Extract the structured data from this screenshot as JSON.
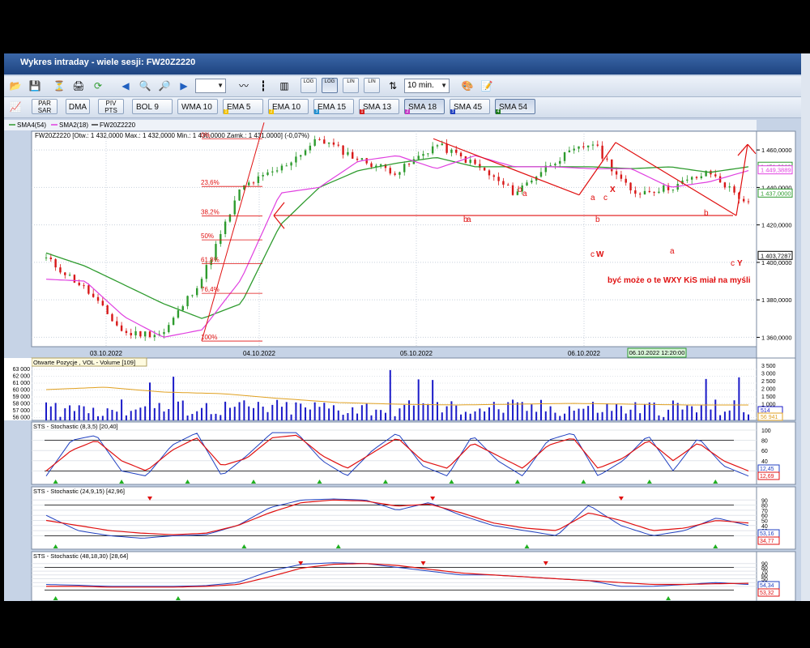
{
  "window": {
    "title": "Wykres intraday -  wiele sesji: FW20Z2220"
  },
  "toolbar1": {
    "interval": "10 min.",
    "icons": [
      "open-folder-icon",
      "save-icon",
      "hourglass-icon",
      "print-icon",
      "refresh-icon",
      "arrow-left-icon",
      "zoom-in-icon",
      "zoom-out-icon",
      "arrow-right-icon",
      "line-chart-icon",
      "ohlc-chart-icon",
      "candle-chart-icon",
      "log-icon",
      "log-icon",
      "lin-icon",
      "lin-icon",
      "scale-icon",
      "palette-icon",
      "notes-icon"
    ],
    "log_labels": [
      "LOG",
      "LOG",
      "LIN",
      "LIN"
    ]
  },
  "toolbar2": {
    "items": [
      {
        "label": "PAR\nSAR",
        "param": "",
        "color": ""
      },
      {
        "label": "DMA",
        "param": "",
        "color": ""
      },
      {
        "label": "PIV\nPTS",
        "param": "",
        "color": ""
      },
      {
        "label": "BOL",
        "param": "9",
        "color": ""
      },
      {
        "label": "WMA",
        "param": "10",
        "color": "#f0c000"
      },
      {
        "label": "EMA",
        "param": "5",
        "color": "#f0c000"
      },
      {
        "label": "EMA",
        "param": "10",
        "color": "#2a9d2a"
      },
      {
        "label": "EMA",
        "param": "15",
        "color": "#1f8fd0"
      },
      {
        "label": "SMA",
        "param": "13",
        "color": "#d42020"
      },
      {
        "label": "SMA",
        "param": "18",
        "color": "#c43bc4"
      },
      {
        "label": "SMA",
        "param": "45",
        "color": "#2040c0"
      },
      {
        "label": "SMA",
        "param": "54",
        "color": "#207a20"
      }
    ],
    "small_numbers": [
      "1",
      "2",
      "3",
      "1",
      "2",
      "3",
      "4"
    ]
  },
  "legend": [
    {
      "name": "SMA4(54)",
      "color": "#2e9b2e"
    },
    {
      "name": "SMA2(18)",
      "color": "#e040e0"
    },
    {
      "name": "FW20Z2220",
      "color": "#333333"
    }
  ],
  "price_header": "FW20Z2220 [Otw.: 1 432,0000  Max.: 1 432,0000  Min.: 1 430,0000  Zamk.: 1 431,0000] (-0,07%)",
  "annotation_text": "być może o te WXY KiS miał na myśli",
  "fib_labels": [
    "0%",
    "23,6%",
    "38,2%",
    "50%",
    "61,8%",
    "76,4%",
    "100%"
  ],
  "wave_labels": [
    "a",
    "b",
    "a",
    "b",
    "c",
    "X",
    "c",
    "W",
    "a",
    "b",
    "a",
    "b",
    "c",
    "Y"
  ],
  "date_ticks": [
    "03.10.2022",
    "04.10.2022",
    "05.10.2022",
    "06.10.2022"
  ],
  "cursor_date": "06.10.2022 12:20:00",
  "price_axis": {
    "ticks": [
      "1 460,0000",
      "1 440,0000",
      "1 420,0000",
      "1 400,0000",
      "1 380,0000",
      "1 360,0000"
    ],
    "markers": [
      {
        "text": "1 451,2963",
        "color": "#2e9b2e"
      },
      {
        "text": "1 449,3889",
        "color": "#e040e0"
      },
      {
        "text": "1 437,0000",
        "color": "#2e9b2e"
      },
      {
        "text": "1 403,7287",
        "color": "#000000"
      }
    ]
  },
  "volume_panel": {
    "title": "Otwarte Pozycje , VOL - Volume [109]",
    "left_ticks": [
      "63 000",
      "62 000",
      "61 000",
      "60 000",
      "59 000",
      "58 000",
      "57 000",
      "56 000"
    ],
    "right_ticks": [
      "3 500",
      "3 000",
      "2 500",
      "2 000",
      "1 500",
      "1 000",
      "500"
    ],
    "markers": [
      "514",
      "56 941"
    ]
  },
  "stoch_panels": [
    {
      "title": "STS - Stochastic (8,3,5) [20,40]",
      "ticks": [
        "100",
        "80",
        "60",
        "40",
        "20"
      ],
      "markers": [
        "12,45",
        "12,69"
      ]
    },
    {
      "title": "STS - Stochastic (24,9,15) [42,96]",
      "ticks": [
        "90",
        "80",
        "70",
        "60",
        "50",
        "40",
        "30",
        "20"
      ],
      "markers": [
        "53,16",
        "34,77"
      ]
    },
    {
      "title": "STS - Stochastic (48,18,30) [28,64]",
      "ticks": [
        "90",
        "80",
        "70",
        "60",
        "50",
        "40",
        "30"
      ],
      "markers": [
        "54,34",
        "53,32"
      ]
    }
  ],
  "colors": {
    "up": "#2e9b2e",
    "down": "#d81818",
    "sma54": "#2e9b2e",
    "sma18": "#e040e0",
    "volume": "#1a1ac8",
    "oi": "#e0a020",
    "red": "#e01010",
    "stoch_k": "#2040c0",
    "stoch_d": "#e01010"
  },
  "chart_data": {
    "type": "line",
    "title": "FW20Z2220",
    "ylabel": "",
    "ylim": [
      1355,
      1470
    ],
    "x": [
      "03.10.2022",
      "04.10.2022",
      "05.10.2022",
      "06.10.2022"
    ],
    "series": [
      {
        "name": "FW20Z2220",
        "values": [
          1402,
          1386,
          1362,
          1362,
          1392,
          1440,
          1450,
          1466,
          1455,
          1448,
          1463,
          1452,
          1437,
          1454,
          1464,
          1437,
          1440,
          1448,
          1431
        ]
      },
      {
        "name": "SMA2(18)",
        "values": [
          1391,
          1390,
          1371,
          1360,
          1364,
          1391,
          1437,
          1440,
          1454,
          1457,
          1450,
          1457,
          1451,
          1451,
          1450,
          1450,
          1440,
          1443,
          1449
        ]
      },
      {
        "name": "SMA4(54)",
        "values": [
          1405,
          1398,
          1388,
          1378,
          1370,
          1378,
          1420,
          1440,
          1449,
          1453,
          1456,
          1451,
          1451,
          1451,
          1451,
          1450,
          1451,
          1448,
          1451
        ]
      }
    ]
  }
}
